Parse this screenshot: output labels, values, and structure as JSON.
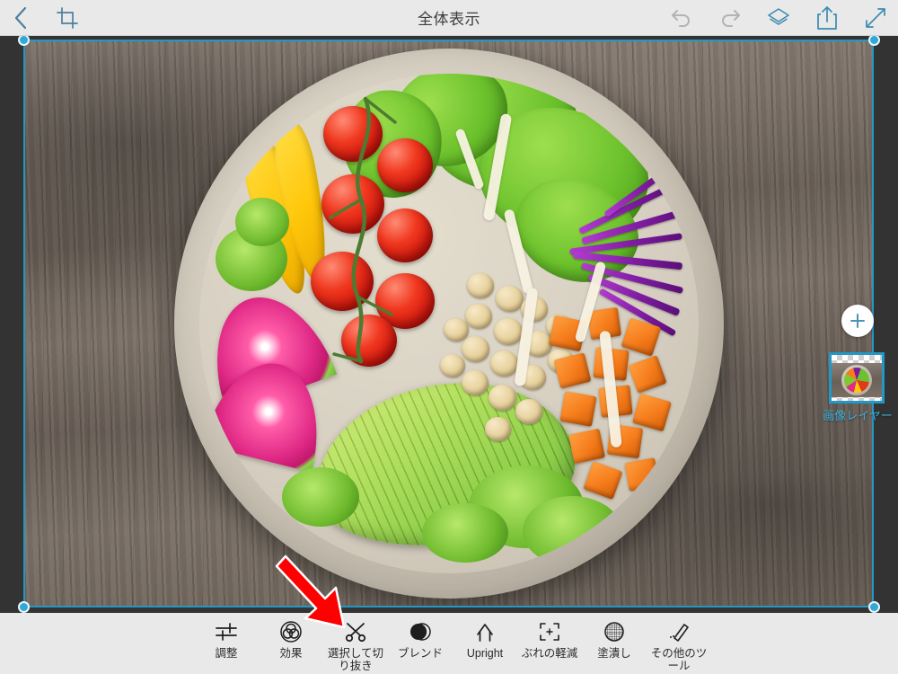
{
  "app": {
    "title": "全体表示",
    "accent_color": "#2397c6",
    "background_color": "#333333",
    "bar_color": "#e9e9e9"
  },
  "topbar": {
    "back_label": "",
    "back_icon": "chevron-left-icon",
    "crop_icon": "crop-icon",
    "title": "全体表示",
    "actions": [
      {
        "name": "undo-button",
        "icon": "undo-icon",
        "enabled": false
      },
      {
        "name": "redo-button",
        "icon": "redo-icon",
        "enabled": false
      },
      {
        "name": "layers-button",
        "icon": "layers-icon",
        "enabled": true
      },
      {
        "name": "share-button",
        "icon": "share-icon",
        "enabled": true
      },
      {
        "name": "fullscreen-button",
        "icon": "expand-icon",
        "enabled": true
      }
    ]
  },
  "canvas": {
    "selection_handles": 4,
    "image_description": "salad bowl photo",
    "border_color": "#2397c6",
    "handle_color": "#30a8d8"
  },
  "layers_panel": {
    "add_button_label": "+",
    "add_button_icon": "plus-icon",
    "layer_name": "画像レイヤー",
    "thumbnail_name": "layer-thumbnail"
  },
  "annotation": {
    "arrow_color": "#ff0000",
    "points_to": "選択して切り抜き"
  },
  "bottom_toolbar": {
    "tools": [
      {
        "label": "調整",
        "icon": "sliders-icon",
        "name": "tool-adjust"
      },
      {
        "label": "効果",
        "icon": "venn-circles-icon",
        "name": "tool-effects"
      },
      {
        "label": "選択して切り抜き",
        "icon": "scissors-icon",
        "name": "tool-select-and-cut"
      },
      {
        "label": "ブレンド",
        "icon": "blend-circle-icon",
        "name": "tool-blend"
      },
      {
        "label": "Upright",
        "icon": "arrow-up-icon",
        "name": "tool-upright"
      },
      {
        "label": "ぶれの軽減",
        "icon": "corner-brackets-icon",
        "name": "tool-deblur"
      },
      {
        "label": "塗潰し",
        "icon": "sphere-grid-icon",
        "name": "tool-fill"
      },
      {
        "label": "その他のツール",
        "icon": "pencil-icon",
        "name": "tool-more-tools"
      }
    ]
  }
}
